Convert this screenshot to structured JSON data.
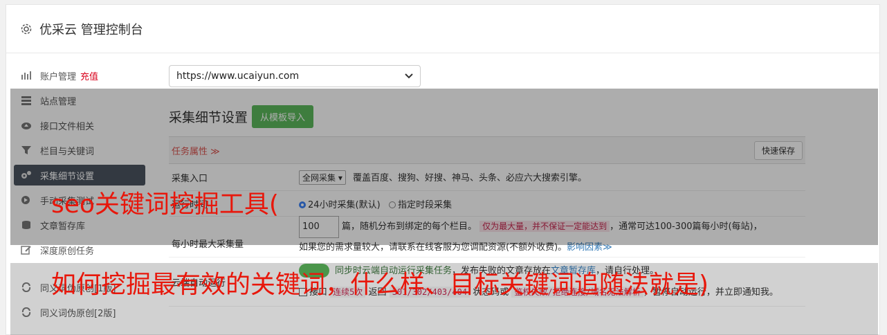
{
  "header": {
    "title": "优采云 管理控制台"
  },
  "sidebar": {
    "items": [
      {
        "label": "账户管理",
        "extra": "充值"
      },
      {
        "label": "站点管理"
      },
      {
        "label": "接口文件相关"
      },
      {
        "label": "栏目与关键词"
      },
      {
        "label": "采集细节设置"
      },
      {
        "label": "手动采集测试"
      },
      {
        "label": "文章暂存库"
      },
      {
        "label": "深度原创任务"
      },
      {
        "label": "同义词伪原创[1版]"
      },
      {
        "label": "同义词伪原创[2版]"
      }
    ]
  },
  "content": {
    "site_select": "https://www.ucaiyun.com",
    "section_title": "采集细节设置",
    "import_button": "从模板导入",
    "task_attr": "任务属性 ≫",
    "quick_save": "快速保存",
    "rows": {
      "entry": {
        "label": "采集入口",
        "select": "全网采集",
        "desc": "覆盖百度、搜狗、好搜、神马、头条、必应六大搜索引擎。"
      },
      "runtime": {
        "label": "运行时间",
        "opt1": "24小时采集(默认)",
        "opt2": "指定时段采集"
      },
      "max": {
        "label": "每小时最大采集量",
        "value": "100",
        "t1": "篇，随机分布到绑定的每个栏目。",
        "hl": "仅为最大量，并不保证一定能达到",
        "t2": "，通常可达100-300篇每小时(每站)，",
        "t3": "如果您的需求量较大，请联系在线客服为您调配资源(不额外收费)。",
        "link": "影响因素≫"
      },
      "cloud": {
        "label": "云端自动运行",
        "green": "同步时云端自动运行采集任务",
        "t1": "，发布失败的文章存放在",
        "link": "文章暂存库",
        "t2": "，请自行处理。",
        "chk": "接口",
        "h1": "连续5次",
        "t3": "返回",
        "h2": "301/302/403/404",
        "t4": "状态码或",
        "h3": "鉴权失败/拒绝连接/域名无法解析",
        "t5": "，暂停自动运行，并立即通知我。"
      }
    }
  },
  "overlay": {
    "line1": "seo关键词挖掘工具(",
    "line2": "如何挖掘最有效的关键词，什么样、目标关键词追随法就是)"
  }
}
